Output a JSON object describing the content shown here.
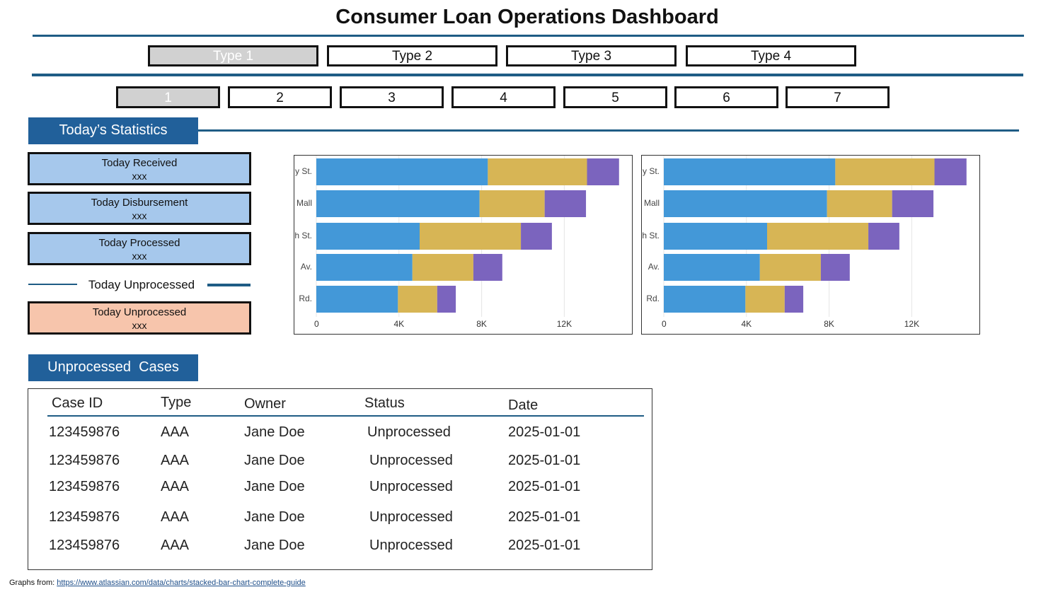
{
  "title": "Consumer Loan Operations Dashboard",
  "type_tabs": [
    {
      "label": "Type 1",
      "active": true
    },
    {
      "label": "Type 2",
      "active": false
    },
    {
      "label": "Type 3",
      "active": false
    },
    {
      "label": "Type 4",
      "active": false
    }
  ],
  "number_tabs": [
    {
      "label": "1",
      "active": true
    },
    {
      "label": "2",
      "active": false
    },
    {
      "label": "3",
      "active": false
    },
    {
      "label": "4",
      "active": false
    },
    {
      "label": "5",
      "active": false
    },
    {
      "label": "6",
      "active": false
    },
    {
      "label": "7",
      "active": false
    }
  ],
  "stats_section": {
    "header": "Today’s Statistics",
    "cards": [
      {
        "label": "Today Received",
        "value": "xxx"
      },
      {
        "label": "Today Disbursement",
        "value": "xxx"
      },
      {
        "label": "Today Processed",
        "value": "xxx"
      }
    ],
    "unprocessed_divider_label": "Today Unprocessed",
    "unprocessed_card": {
      "label": "Today Unprocessed",
      "value": "xxx"
    }
  },
  "colors": {
    "accent": "#21609a",
    "card_blue": "#a6c8ec",
    "card_peach": "#f7c5ac",
    "series_1": "#4398d8",
    "series_2": "#d7b555",
    "series_3": "#7b64be"
  },
  "chart_data": [
    {
      "type": "bar",
      "orientation": "horizontal",
      "stacked": true,
      "categories": [
        "y St.",
        "Mall",
        "h St.",
        "Av.",
        "Rd."
      ],
      "series": [
        {
          "values": [
            8300,
            7900,
            5000,
            4650,
            3950
          ]
        },
        {
          "values": [
            4800,
            3150,
            4900,
            2950,
            1900
          ]
        },
        {
          "values": [
            1550,
            2000,
            1500,
            1400,
            900
          ]
        }
      ],
      "xlim": [
        0,
        15000
      ],
      "xticks": [
        "0",
        "4K",
        "8K",
        "12K"
      ],
      "xtick_values": [
        0,
        4000,
        8000,
        12000
      ],
      "grid": true
    },
    {
      "type": "bar",
      "orientation": "horizontal",
      "stacked": true,
      "categories": [
        "y St.",
        "Mall",
        "h St.",
        "Av.",
        "Rd."
      ],
      "series": [
        {
          "values": [
            8300,
            7900,
            5000,
            4650,
            3950
          ]
        },
        {
          "values": [
            4800,
            3150,
            4900,
            2950,
            1900
          ]
        },
        {
          "values": [
            1550,
            2000,
            1500,
            1400,
            900
          ]
        }
      ],
      "xlim": [
        0,
        15000
      ],
      "xticks": [
        "0",
        "4K",
        "8K",
        "12K"
      ],
      "xtick_values": [
        0,
        4000,
        8000,
        12000
      ],
      "grid": true
    }
  ],
  "cases_section": {
    "header": "Unprocessed  Cases",
    "columns": [
      "Case ID",
      "Type",
      "Owner",
      "Status",
      "Date"
    ],
    "rows": [
      [
        "123459876",
        "AAA",
        "Jane Doe",
        "Unprocessed",
        "2025-01-01"
      ],
      [
        "123459876",
        "AAA",
        "Jane Doe",
        "Unprocessed",
        "2025-01-01"
      ],
      [
        "123459876",
        "AAA",
        "Jane Doe",
        "Unprocessed",
        "2025-01-01"
      ],
      [
        "123459876",
        "AAA",
        "Jane Doe",
        "Unprocessed",
        "2025-01-01"
      ],
      [
        "123459876",
        "AAA",
        "Jane Doe",
        "Unprocessed",
        "2025-01-01"
      ]
    ]
  },
  "footer": {
    "prefix": "Graphs from: ",
    "link_text": "https://www.atlassian.com/data/charts/stacked-bar-chart-complete-guide"
  }
}
